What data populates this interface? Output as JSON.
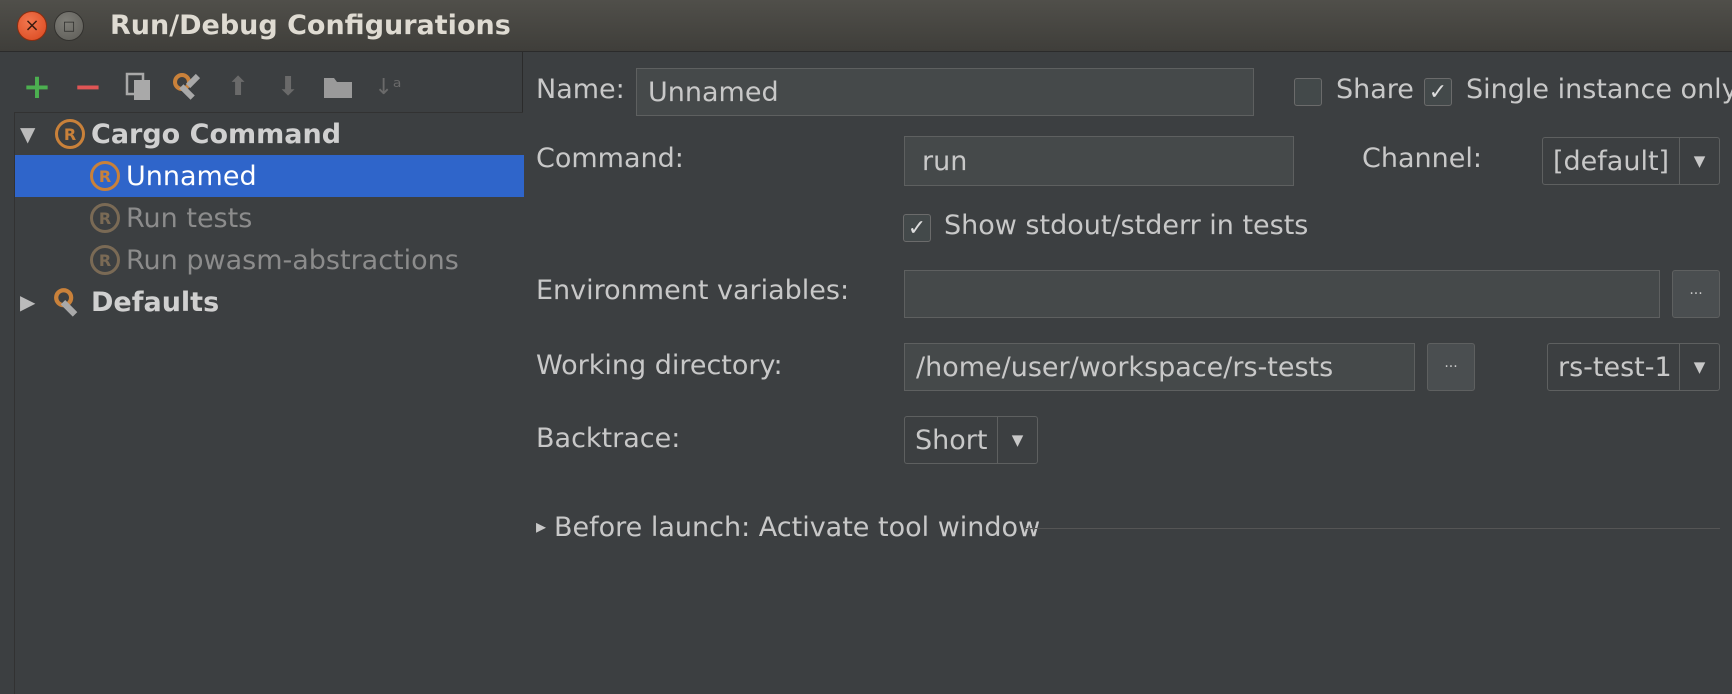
{
  "window": {
    "title": "Run/Debug Configurations",
    "close_glyph": "×",
    "minimize_glyph": "□"
  },
  "toolbar": {
    "icons": [
      "add-icon",
      "remove-icon",
      "copy-icon",
      "edit-defaults-icon",
      "move-up-icon",
      "move-down-icon",
      "folder-icon",
      "sort-alpha-icon"
    ],
    "add_glyph": "+",
    "remove_glyph": "−",
    "up_glyph": "⬆",
    "down_glyph": "⬇",
    "sort_glyph": "↓ᵃ"
  },
  "tree": {
    "group_label": "Cargo Command",
    "items": [
      {
        "label": "Unnamed",
        "selected": true
      },
      {
        "label": "Run tests",
        "selected": false
      },
      {
        "label": "Run pwasm-abstractions",
        "selected": false
      }
    ],
    "defaults_label": "Defaults",
    "expanded_glyph": "▼",
    "collapsed_glyph": "▶",
    "rust_glyph": "R"
  },
  "form": {
    "name_label": "Name:",
    "name_value": "Unnamed",
    "share_label": "Share",
    "share_checked": false,
    "single_instance_label": "Single instance only",
    "single_instance_checked": true,
    "command_label": "Command:",
    "command_value": "run",
    "channel_label": "Channel:",
    "channel_value": "[default]",
    "show_stdout_label": "Show stdout/stderr in tests",
    "show_stdout_checked": true,
    "env_label": "Environment variables:",
    "env_value": "",
    "browse_glyph": "···",
    "workdir_label": "Working directory:",
    "workdir_value": "/home/user/workspace/rs-tests",
    "workdir_module": "rs-test-1",
    "backtrace_label": "Backtrace:",
    "backtrace_value": "Short",
    "before_launch_label": "Before launch: Activate tool window",
    "expand_glyph": "▸",
    "dropdown_glyph": "▼",
    "check_glyph": "✓"
  },
  "colors": {
    "background": "#3c3f41",
    "selection": "#2f65ca",
    "add": "#4caf50",
    "remove": "#e05555",
    "rust": "#c9813a"
  }
}
